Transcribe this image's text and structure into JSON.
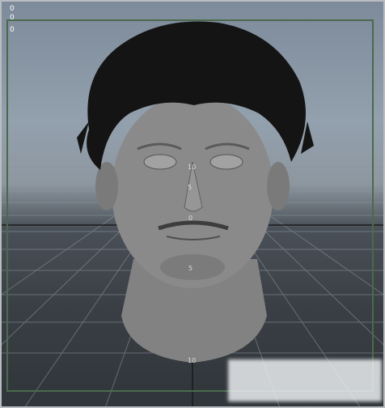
{
  "viewport": {
    "hud_values": [
      "0",
      "0",
      "0"
    ],
    "axis_labels": [
      "10",
      "5",
      "0",
      "5",
      "10"
    ]
  },
  "colors": {
    "background_top": "#7d8a9a",
    "background_bottom": "#30353a",
    "frame": "#4b6a4b",
    "grid": "#8f969c",
    "axis": "#111111",
    "skin": "#8b8b8b"
  },
  "icons": [
    "head-model-icon",
    "hair-icon"
  ]
}
